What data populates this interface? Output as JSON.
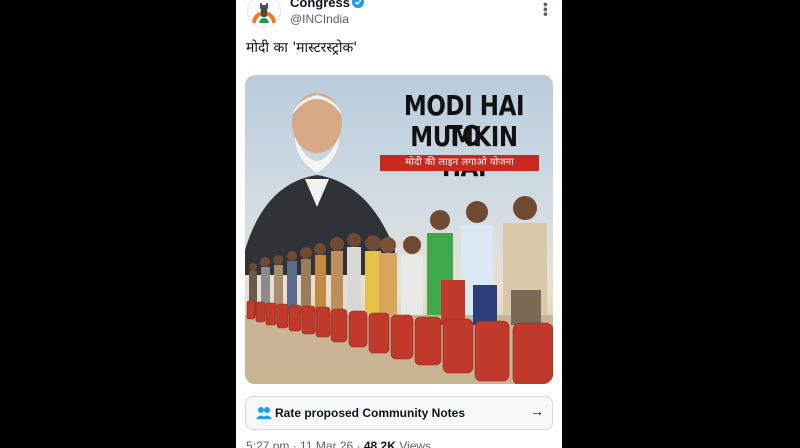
{
  "tweet": {
    "author_name": "Congress",
    "author_handle": "@INCIndia",
    "text": "मोदी का 'मास्टरस्ट्रोक'",
    "verified_icon": "verified-badge-icon",
    "more_icon": "more-options-icon"
  },
  "media": {
    "headline_line1": "MODI HAI TO",
    "headline_line2": "MUMKIN HAI",
    "subheadline": "मोदी की लाइन लगाओ योजना",
    "band_color": "#c8281f",
    "cylinder_color": "#c0392b"
  },
  "community_notes": {
    "label": "Rate proposed Community Notes",
    "icon": "people-icon",
    "arrow_icon": "arrow-right-icon"
  },
  "meta": {
    "time": "5:27 pm",
    "separator": "·",
    "date": "11 Mar 26",
    "views_count": "48.2K",
    "views_label": "Views"
  },
  "colors": {
    "page_background": "#000000",
    "card_background": "#ffffff",
    "secondary_text": "#536471",
    "verified_blue": "#1d9bf0"
  }
}
